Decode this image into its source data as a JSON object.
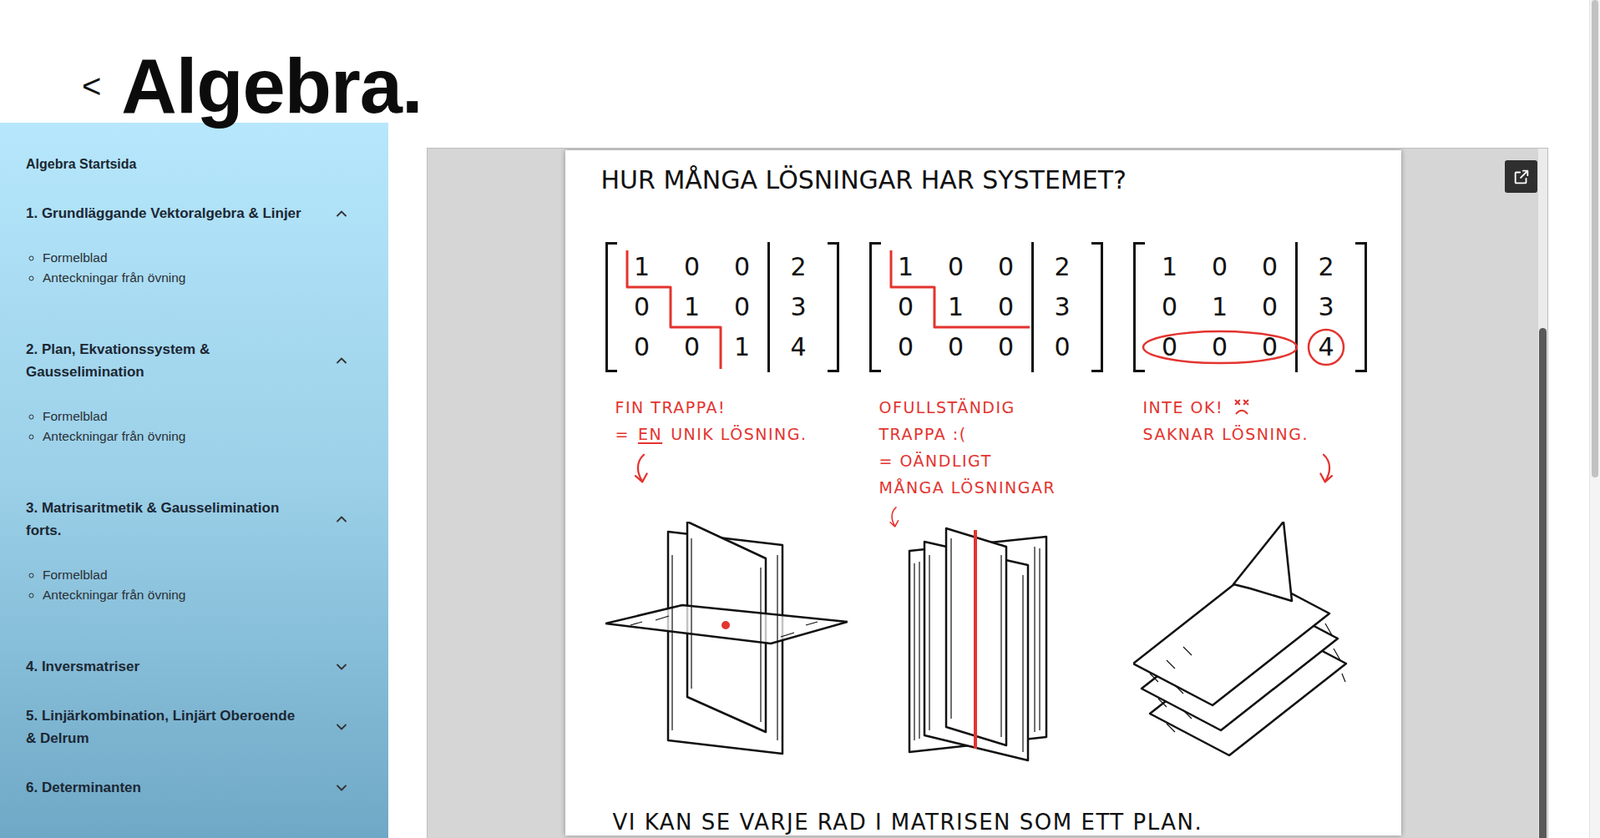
{
  "header": {
    "back": "<",
    "title": "Algebra."
  },
  "sidebar": {
    "home": "Algebra Startsida",
    "sections": [
      {
        "title": "1. Grundläggande Vektoralgebra & Linjer",
        "expanded": true,
        "items": [
          "Formelblad",
          "Anteckningar från övning"
        ]
      },
      {
        "title": "2. Plan, Ekvationssystem & Gausselimination",
        "expanded": true,
        "items": [
          "Formelblad",
          "Anteckningar från övning"
        ]
      },
      {
        "title": "3. Matrisaritmetik & Gausselimination forts.",
        "expanded": true,
        "items": [
          "Formelblad",
          "Anteckningar från övning"
        ]
      },
      {
        "title": "4. Inversmatriser",
        "expanded": false,
        "items": []
      },
      {
        "title": "5. Linjärkombination, Linjärt Oberoende & Delrum",
        "expanded": false,
        "items": []
      },
      {
        "title": "6. Determinanten",
        "expanded": false,
        "items": []
      }
    ]
  },
  "viewer": {
    "scroll_thumb_start": 0.26,
    "page": {
      "heading": "HUR MÅNGA LÖSNINGAR HAR SYSTEMET?",
      "cases": [
        {
          "kind": "unique",
          "rows": [
            {
              "coefficients": [
                "1",
                "0",
                "0"
              ],
              "constant": "2"
            },
            {
              "coefficients": [
                "0",
                "1",
                "0"
              ],
              "constant": "3"
            },
            {
              "coefficients": [
                "0",
                "0",
                "1"
              ],
              "constant": "4"
            }
          ],
          "caption": [
            [
              {
                "text": "FIN TRAPPA!",
                "underline": false
              }
            ],
            [
              {
                "text": "=",
                "underline": false
              },
              {
                "text": "EN",
                "underline": true
              },
              {
                "text": "UNIK LÖSNING.",
                "underline": false
              }
            ]
          ]
        },
        {
          "kind": "infinite",
          "rows": [
            {
              "coefficients": [
                "1",
                "0",
                "0"
              ],
              "constant": "2"
            },
            {
              "coefficients": [
                "0",
                "1",
                "0"
              ],
              "constant": "3"
            },
            {
              "coefficients": [
                "0",
                "0",
                "0"
              ],
              "constant": "0"
            }
          ],
          "caption": [
            [
              {
                "text": "OFULLSTÄNDIG",
                "underline": false
              }
            ],
            [
              {
                "text": "TRAPPA :(",
                "underline": false
              }
            ],
            [
              {
                "text": "= OÄNDLIGT",
                "underline": false
              }
            ],
            [
              {
                "text": "MÅNGA LÖSNINGAR",
                "underline": false
              }
            ]
          ]
        },
        {
          "kind": "none",
          "rows": [
            {
              "coefficients": [
                "1",
                "0",
                "0"
              ],
              "constant": "2"
            },
            {
              "coefficients": [
                "0",
                "1",
                "0"
              ],
              "constant": "3"
            },
            {
              "coefficients": [
                "0",
                "0",
                "0"
              ],
              "constant": "4"
            }
          ],
          "caption": [
            [
              {
                "text": "INTE OK!",
                "underline": false
              }
            ],
            [
              {
                "text": "SAKNAR LÖSNING.",
                "underline": false
              }
            ]
          ]
        }
      ],
      "footer": "VI KAN SE VARJE RAD I MATRISEN SOM ETT PLAN."
    }
  },
  "page_scrollbar": {
    "thumb_size": 0.57
  }
}
